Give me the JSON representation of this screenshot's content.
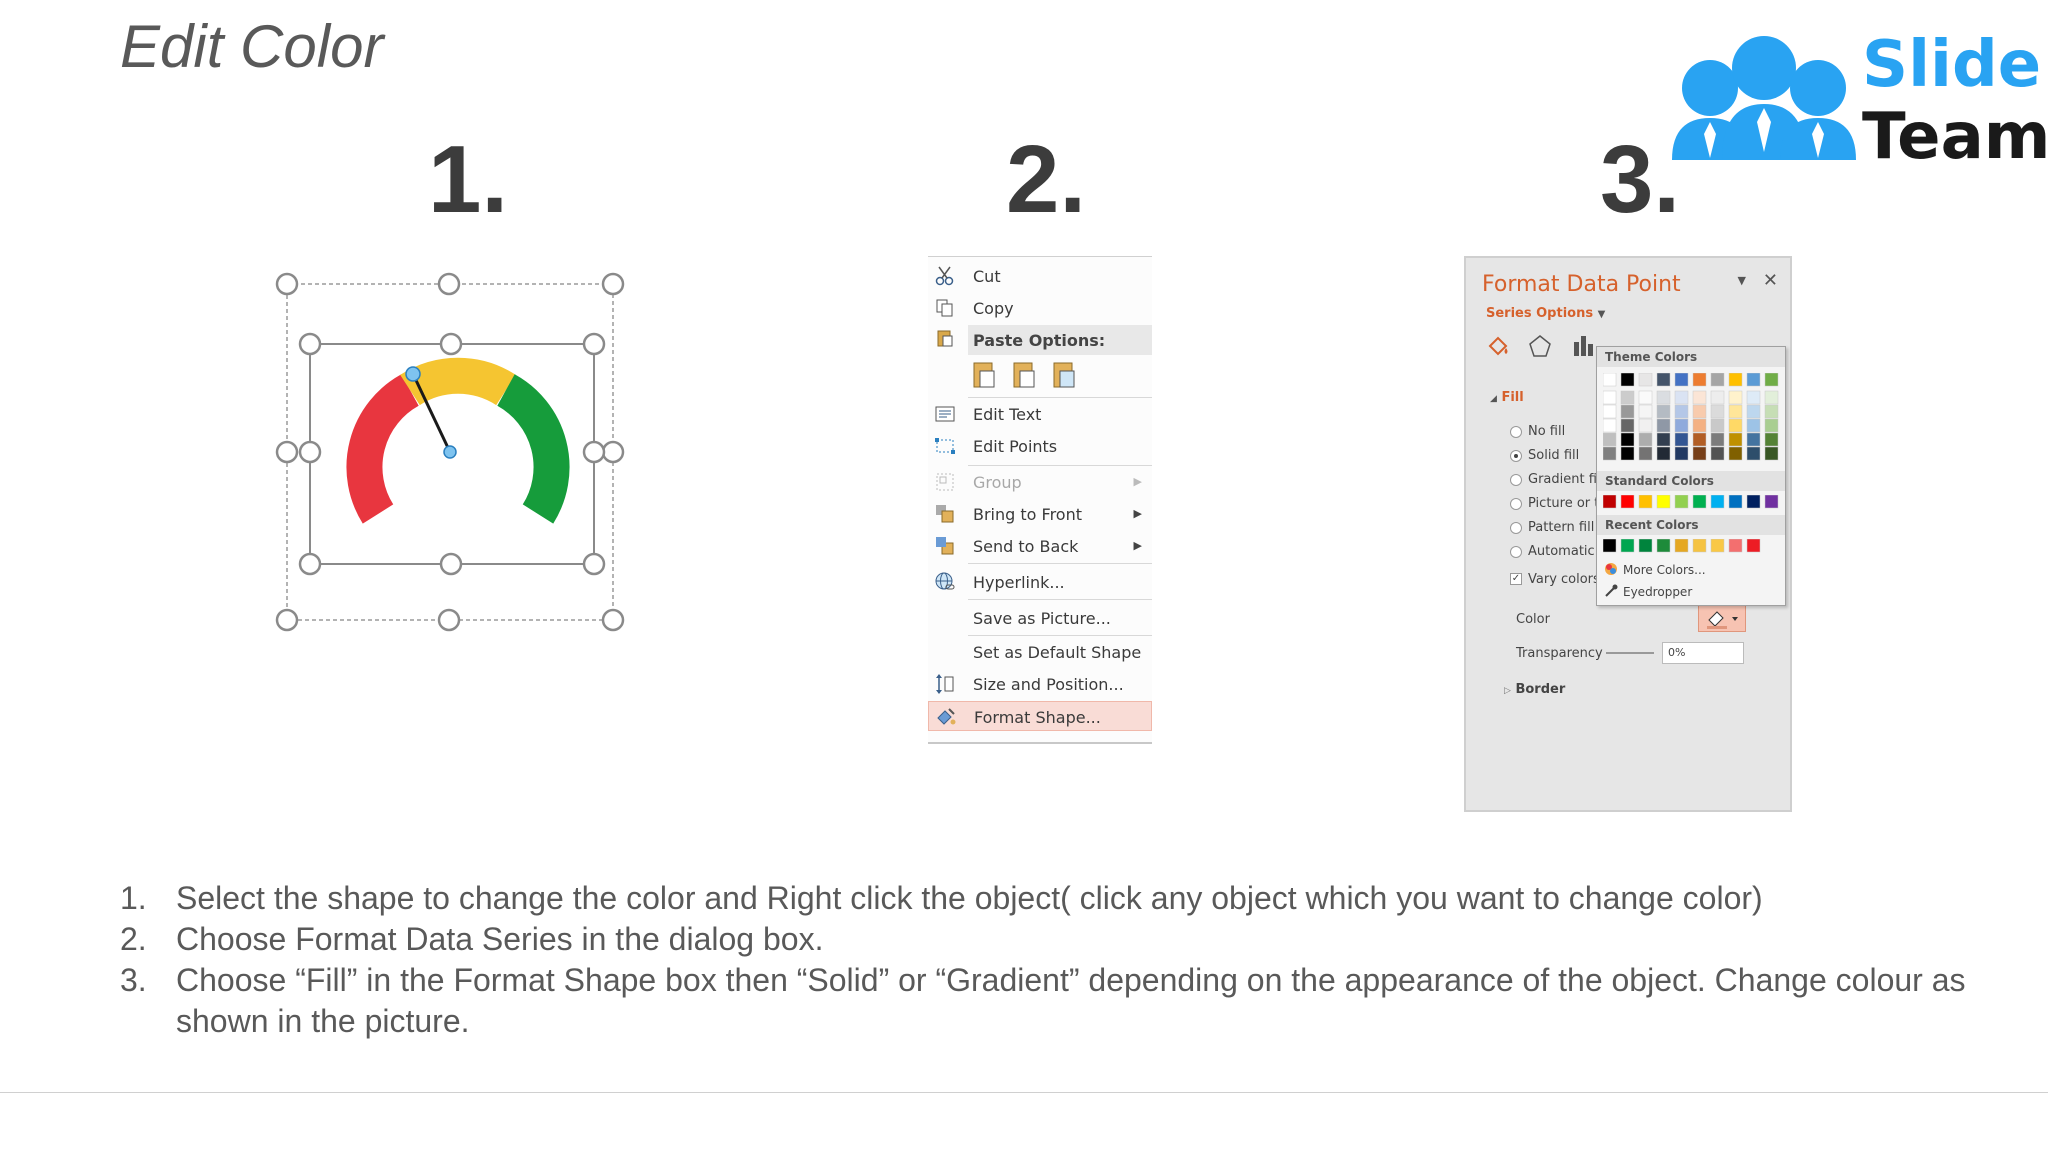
{
  "slide": {
    "title": "Edit Color"
  },
  "logo": {
    "line1": "Slide",
    "line2": "Team"
  },
  "steps": [
    "1.",
    "2.",
    "3."
  ],
  "context_menu": {
    "items": [
      {
        "label": "Cut",
        "icon": "scissors-icon",
        "disabled": false
      },
      {
        "label": "Copy",
        "icon": "copy-icon",
        "disabled": false
      },
      {
        "label": "Paste Options:",
        "icon": "paste-icon",
        "header": true
      },
      {
        "label": "Edit Text",
        "icon": "edit-text-icon",
        "disabled": false
      },
      {
        "label": "Edit Points",
        "icon": "edit-points-icon",
        "disabled": false
      },
      {
        "label": "Group",
        "icon": "group-icon",
        "disabled": true
      },
      {
        "label": "Bring to Front",
        "icon": "bring-front-icon",
        "disabled": false
      },
      {
        "label": "Send to Back",
        "icon": "send-back-icon",
        "disabled": false
      },
      {
        "label": "Hyperlink...",
        "icon": "hyperlink-icon",
        "disabled": false
      },
      {
        "label": "Save as Picture...",
        "icon": "",
        "disabled": false
      },
      {
        "label": "Set as Default Shape",
        "icon": "",
        "disabled": false
      },
      {
        "label": "Size and Position...",
        "icon": "size-position-icon",
        "disabled": false
      },
      {
        "label": "Format Shape...",
        "icon": "format-shape-icon",
        "disabled": false,
        "selected": true
      }
    ]
  },
  "format_panel": {
    "title": "Format Data Point",
    "series_options": "Series Options",
    "fill_header": "Fill",
    "fill_options": [
      {
        "label": "No fill",
        "selected": false
      },
      {
        "label": "Solid fill",
        "selected": true
      },
      {
        "label": "Gradient fill",
        "selected": false
      },
      {
        "label": "Picture or te",
        "selected": false
      },
      {
        "label": "Pattern fill",
        "selected": false
      },
      {
        "label": "Automatic",
        "selected": false
      }
    ],
    "vary_colors": "Vary colors I",
    "color_label": "Color",
    "transparency_label": "Transparency",
    "transparency_value": "0%",
    "border_header": "Border"
  },
  "palette": {
    "theme_header": "Theme Colors",
    "standard_header": "Standard Colors",
    "recent_header": "Recent Colors",
    "more_colors": "More Colors...",
    "eyedropper": "Eyedropper",
    "theme_top": [
      "#ffffff",
      "#000000",
      "#e7e6e6",
      "#44546a",
      "#4472c4",
      "#ed7d31",
      "#a5a5a5",
      "#ffc000",
      "#5b9bd5",
      "#70ad47"
    ],
    "standard": [
      "#c00000",
      "#ff0000",
      "#ffc000",
      "#ffff00",
      "#92d050",
      "#00b050",
      "#00b0f0",
      "#0070c0",
      "#002060",
      "#7030a0"
    ],
    "recent": [
      "#000000",
      "#00a651",
      "#00843d",
      "#1e8b3a",
      "#e5a823",
      "#f5c342",
      "#f9c846",
      "#f36f6f",
      "#ed1c24"
    ]
  },
  "instructions": [
    {
      "num": "1.",
      "text": "Select the shape to change the color and Right click the object( click any object which you want to change color)"
    },
    {
      "num": "2.",
      "text": "Choose Format Data Series in the dialog box."
    },
    {
      "num": "3.",
      "text": "Choose “Fill” in the Format Shape box then “Solid” or “Gradient” depending on the appearance of the object. Change colour as shown in the picture."
    }
  ]
}
